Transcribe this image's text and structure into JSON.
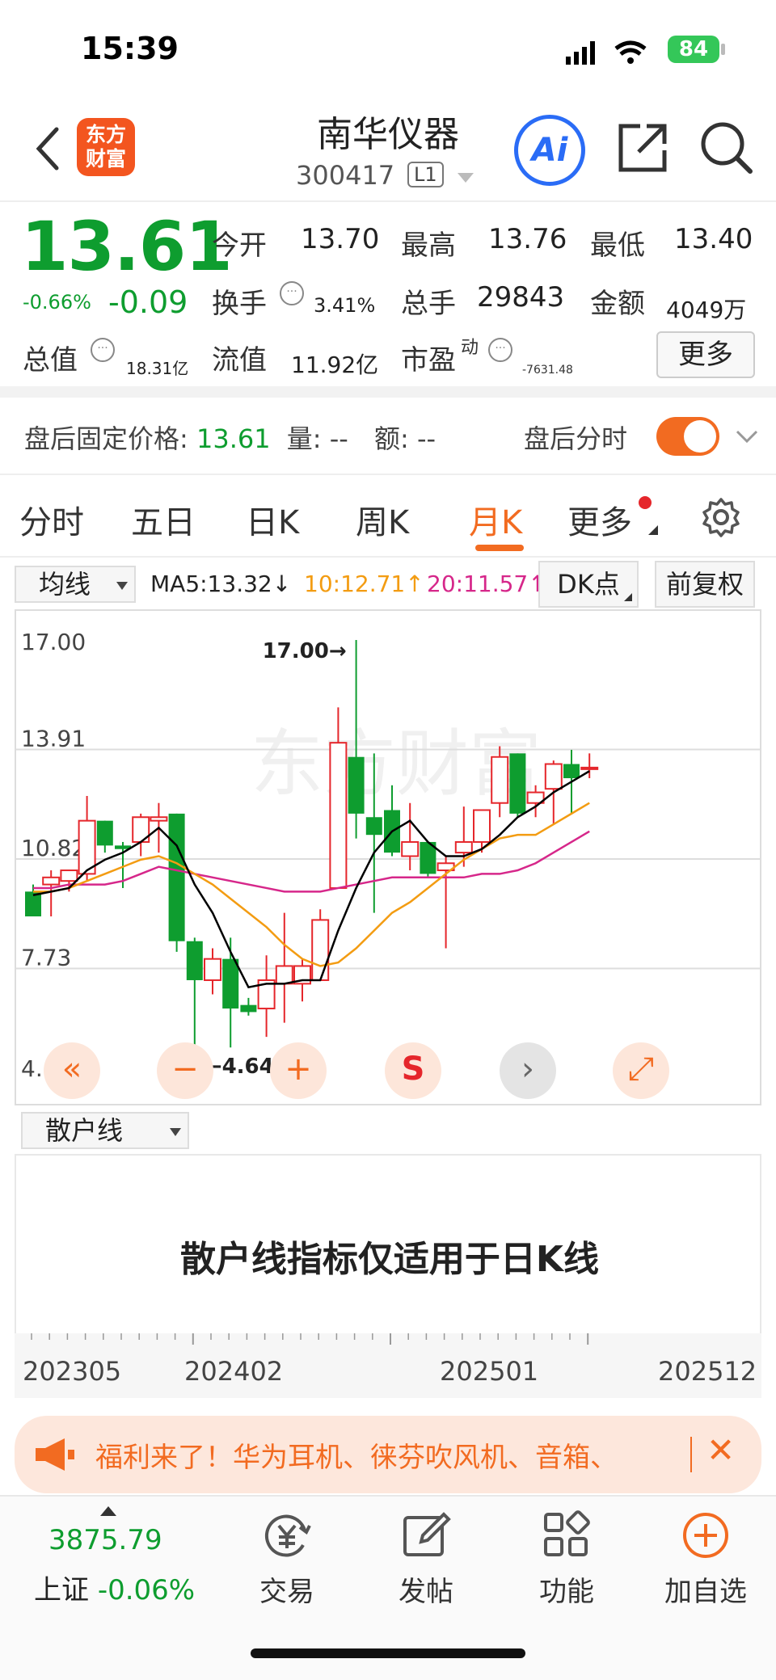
{
  "status": {
    "time": "15:39",
    "battery": "84"
  },
  "header": {
    "logo_line1": "东方",
    "logo_line2": "财富",
    "stock_name": "南华仪器",
    "stock_code": "300417",
    "level": "L1",
    "ai_label": "Ai"
  },
  "quote": {
    "price": "13.61",
    "change_pct": "-0.66%",
    "change": "-0.09",
    "open_label": "今开",
    "open": "13.70",
    "high_label": "最高",
    "high": "13.76",
    "low_label": "最低",
    "low": "13.40",
    "turnover_label": "换手",
    "turnover": "3.41%",
    "volume_label": "总手",
    "volume": "29843",
    "amount_label": "金额",
    "amount": "4049万",
    "total_cap_label": "总值",
    "total_cap": "18.31亿",
    "float_cap_label": "流值",
    "float_cap": "11.92亿",
    "pe_label": "市盈",
    "pe_sup": "动",
    "pe": "-7631.48",
    "more": "更多"
  },
  "after_hours": {
    "label": "盘后固定价格:",
    "price": "13.61",
    "vol_label": "量:",
    "vol": "--",
    "amt_label": "额:",
    "amt": "--",
    "right_label": "盘后分时",
    "toggle_on": true
  },
  "tabs": [
    "分时",
    "五日",
    "日K",
    "周K",
    "月K",
    "更多"
  ],
  "active_tab": "月K",
  "ma_bar": {
    "selector": "均线",
    "ma5": "MA5:13.32↓",
    "ma10": "10:12.71↑",
    "ma20": "20:11.57↑",
    "dk": "DK点",
    "adjust": "前复权",
    "colors": {
      "ma5": "#000000",
      "ma10": "#f39c12",
      "ma20": "#d6278a"
    }
  },
  "chart_data": {
    "type": "candlestick",
    "y_labels": [
      "17.00",
      "13.91",
      "10.82",
      "7.73",
      "4.64"
    ],
    "ylim": [
      4.64,
      17.0
    ],
    "max_marker": "17.00→",
    "min_marker": "←4.64",
    "x_labels": [
      "202305",
      "202402",
      "202501",
      "202512"
    ],
    "candles": [
      {
        "o": 9.9,
        "h": 10.1,
        "l": 9.3,
        "c": 9.2
      },
      {
        "o": 10.1,
        "h": 10.5,
        "l": 9.2,
        "c": 10.3
      },
      {
        "o": 10.2,
        "h": 10.4,
        "l": 9.9,
        "c": 10.5
      },
      {
        "o": 10.4,
        "h": 12.6,
        "l": 10.2,
        "c": 11.9
      },
      {
        "o": 11.9,
        "h": 11.9,
        "l": 11.0,
        "c": 11.2
      },
      {
        "o": 11.2,
        "h": 11.3,
        "l": 10.0,
        "c": 11.1
      },
      {
        "o": 11.3,
        "h": 12.1,
        "l": 10.9,
        "c": 12.0
      },
      {
        "o": 11.9,
        "h": 12.4,
        "l": 11.0,
        "c": 12.0
      },
      {
        "o": 12.1,
        "h": 12.1,
        "l": 8.2,
        "c": 8.5
      },
      {
        "o": 8.5,
        "h": 8.6,
        "l": 4.64,
        "c": 7.4
      },
      {
        "o": 7.4,
        "h": 8.3,
        "l": 7.0,
        "c": 8.0
      },
      {
        "o": 8.0,
        "h": 8.6,
        "l": 5.5,
        "c": 6.6
      },
      {
        "o": 6.7,
        "h": 6.9,
        "l": 6.4,
        "c": 6.5
      },
      {
        "o": 6.6,
        "h": 8.1,
        "l": 5.8,
        "c": 7.4
      },
      {
        "o": 7.3,
        "h": 9.3,
        "l": 6.2,
        "c": 7.8
      },
      {
        "o": 7.3,
        "h": 8.0,
        "l": 6.8,
        "c": 7.8
      },
      {
        "o": 7.4,
        "h": 9.4,
        "l": 7.4,
        "c": 9.1
      },
      {
        "o": 10.0,
        "h": 15.1,
        "l": 10.0,
        "c": 14.1
      },
      {
        "o": 13.7,
        "h": 17.0,
        "l": 11.4,
        "c": 12.1
      },
      {
        "o": 12.0,
        "h": 13.8,
        "l": 9.3,
        "c": 11.5
      },
      {
        "o": 12.2,
        "h": 12.9,
        "l": 10.9,
        "c": 11.0
      },
      {
        "o": 10.9,
        "h": 12.4,
        "l": 10.5,
        "c": 11.3
      },
      {
        "o": 11.3,
        "h": 11.3,
        "l": 10.3,
        "c": 10.4
      },
      {
        "o": 10.5,
        "h": 10.9,
        "l": 8.3,
        "c": 10.7
      },
      {
        "o": 11.0,
        "h": 12.3,
        "l": 10.6,
        "c": 11.3
      },
      {
        "o": 11.3,
        "h": 12.0,
        "l": 11.0,
        "c": 12.2
      },
      {
        "o": 12.4,
        "h": 14.0,
        "l": 12.0,
        "c": 13.7
      },
      {
        "o": 13.8,
        "h": 13.8,
        "l": 12.0,
        "c": 12.1
      },
      {
        "o": 12.4,
        "h": 12.9,
        "l": 12.0,
        "c": 12.7
      },
      {
        "o": 12.8,
        "h": 13.6,
        "l": 11.8,
        "c": 13.5
      },
      {
        "o": 13.5,
        "h": 13.9,
        "l": 12.1,
        "c": 13.1
      },
      {
        "o": 13.4,
        "h": 13.8,
        "l": 13.1,
        "c": 13.4
      }
    ],
    "ma5": [
      9.8,
      9.9,
      10.0,
      10.5,
      10.8,
      11.0,
      11.3,
      11.7,
      11.2,
      10.1,
      9.3,
      8.2,
      7.2,
      7.3,
      7.3,
      7.4,
      7.4,
      8.8,
      10.0,
      11.0,
      11.6,
      11.9,
      11.3,
      10.9,
      10.9,
      11.1,
      11.5,
      12.0,
      12.3,
      12.7,
      13.0,
      13.3
    ],
    "ma10": [
      9.9,
      9.9,
      10.0,
      10.2,
      10.4,
      10.6,
      10.8,
      10.9,
      10.7,
      10.4,
      10.1,
      9.7,
      9.3,
      8.9,
      8.4,
      8.0,
      7.8,
      7.9,
      8.3,
      8.8,
      9.3,
      9.6,
      10.0,
      10.4,
      10.8,
      11.1,
      11.4,
      11.5,
      11.5,
      11.8,
      12.1,
      12.4
    ],
    "ma20": [
      10.0,
      10.0,
      10.1,
      10.1,
      10.1,
      10.2,
      10.4,
      10.6,
      10.5,
      10.4,
      10.3,
      10.2,
      10.1,
      10.0,
      9.9,
      9.9,
      9.9,
      10.0,
      10.1,
      10.2,
      10.3,
      10.3,
      10.3,
      10.3,
      10.3,
      10.4,
      10.4,
      10.5,
      10.7,
      11.0,
      11.3,
      11.6
    ]
  },
  "chart_controls": [
    "«",
    "−",
    "+",
    "S",
    "›",
    "⤢"
  ],
  "indicator": {
    "selector": "散户线",
    "message": "散户线指标仅适用于日K线"
  },
  "banner": {
    "text": "福利来了！华为耳机、徕芬吹风机、音箱、",
    "close": "✕"
  },
  "bottom_nav": {
    "index_value": "3875.79",
    "index_name": "上证",
    "index_change": "-0.06%",
    "items": [
      "交易",
      "发帖",
      "功能",
      "加自选"
    ]
  }
}
